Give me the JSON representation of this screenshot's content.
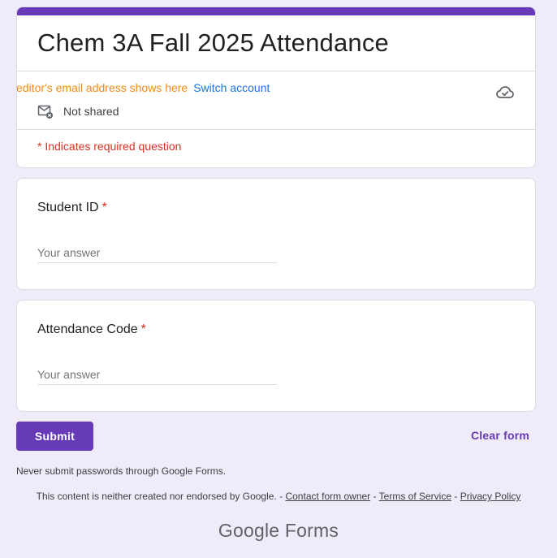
{
  "form": {
    "title": "Chem 3A Fall 2025 Attendance",
    "email_overlay": "editor's email address shows here",
    "switch_account": "Switch account",
    "not_shared": "Not shared",
    "required_note": "* Indicates required question",
    "accent_color": "#673ab7"
  },
  "questions": [
    {
      "label": "Student ID",
      "required_mark": "*",
      "placeholder": "Your answer"
    },
    {
      "label": "Attendance Code",
      "required_mark": "*",
      "placeholder": "Your answer"
    }
  ],
  "actions": {
    "submit": "Submit",
    "clear": "Clear form"
  },
  "footer": {
    "warning": "Never submit passwords through Google Forms.",
    "disclaimer": "This content is neither created nor endorsed by Google. -",
    "contact_owner": "Contact form owner",
    "sep1": "-",
    "terms": "Terms of Service",
    "sep2": "-",
    "privacy": "Privacy Policy",
    "brand_google": "Google",
    "brand_forms": "Forms"
  },
  "icons": {
    "cloud": "cloud-check-icon",
    "mail": "mail-not-shared-icon"
  }
}
